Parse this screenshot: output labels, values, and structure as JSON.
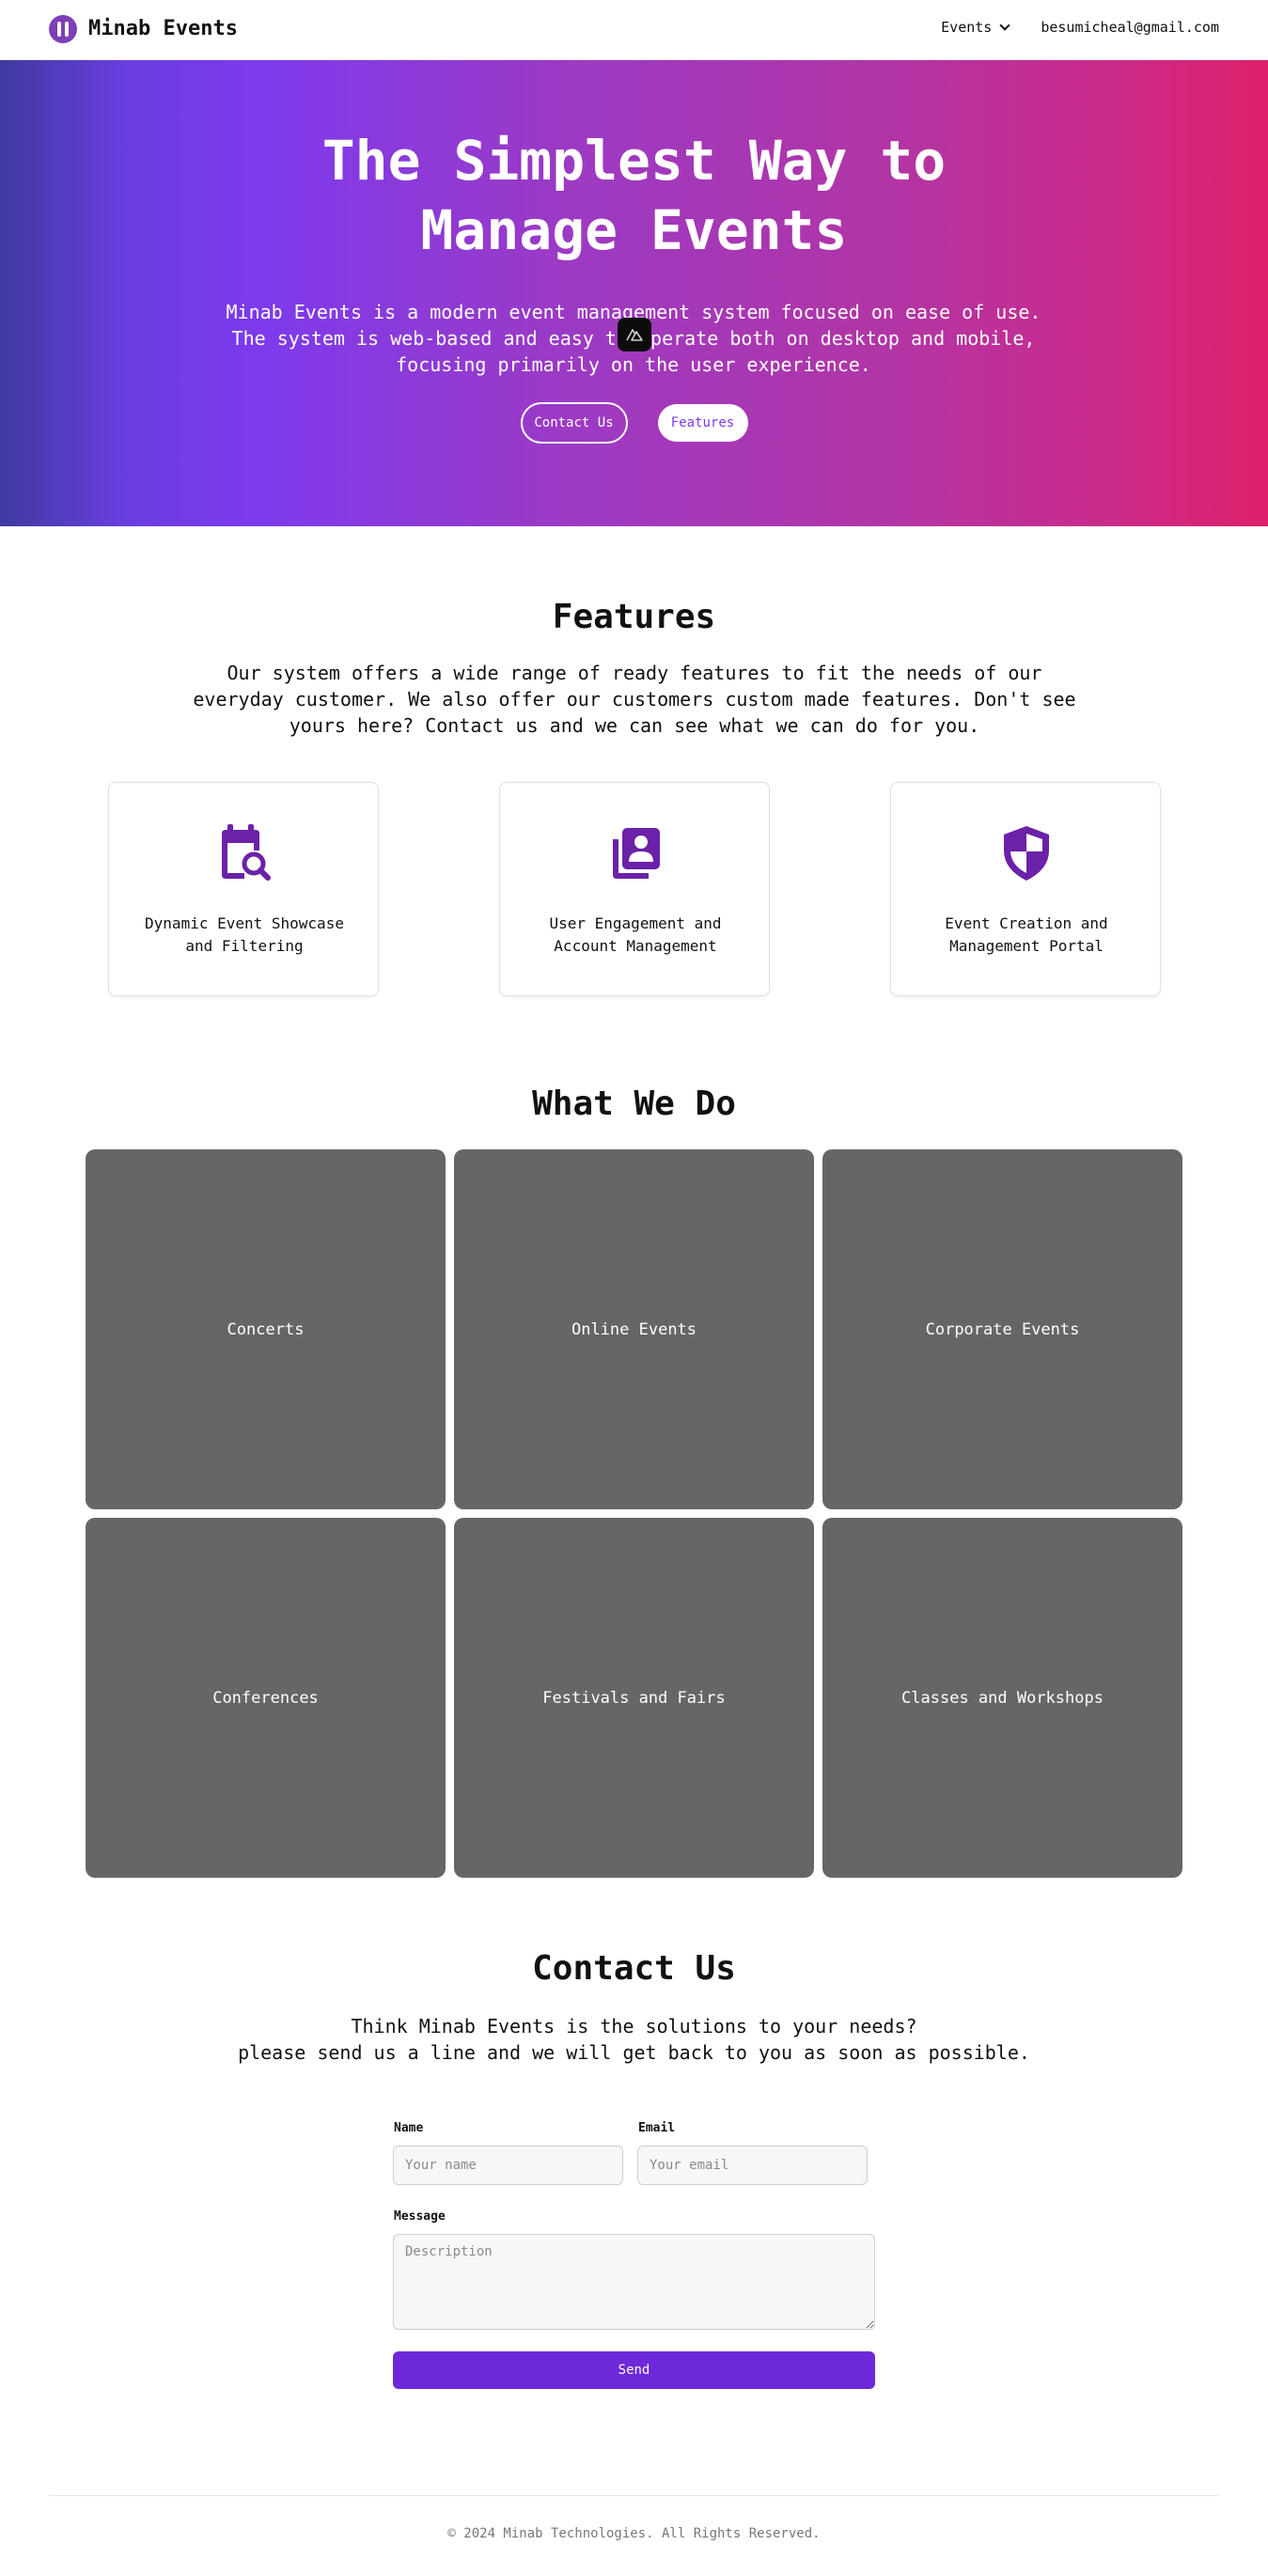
{
  "navbar": {
    "brand_name": "Minab Events",
    "events_label": "Events",
    "email": "besumicheal@gmail.com"
  },
  "hero": {
    "title_line1": "The Simplest Way to",
    "title_line2": "Manage Events",
    "description": "Minab Events is a modern event management system focused on ease of use. The system is web-based and easy to operate both on desktop and mobile, focusing primarily on the user experience.",
    "contact_button": "Contact Us",
    "features_button": "Features"
  },
  "features": {
    "title": "Features",
    "description": "Our system offers a wide range of ready features to fit the needs of our everyday customer. We also offer our customers custom made features. Don't see yours here? Contact us and we can see what we can do for you.",
    "items": [
      {
        "label": "Dynamic Event Showcase and Filtering",
        "icon": "calendar-search-icon"
      },
      {
        "label": "User Engagement and Account Management",
        "icon": "user-card-icon"
      },
      {
        "label": "Event Creation and Management Portal",
        "icon": "shield-icon"
      }
    ]
  },
  "what_we_do": {
    "title": "What We Do",
    "tiles": [
      "Concerts",
      "Online Events",
      "Corporate Events",
      "Conferences",
      "Festivals and Fairs",
      "Classes and Workshops"
    ]
  },
  "contact": {
    "title": "Contact Us",
    "subtitle_line1": "Think Minab Events is the solutions to your needs?",
    "subtitle_line2": "please send us a line and we will get back to you as soon as possible.",
    "name_label": "Name",
    "name_placeholder": "Your name",
    "email_label": "Email",
    "email_placeholder": "Your email",
    "message_label": "Message",
    "message_placeholder": "Description",
    "send_button": "Send"
  },
  "footer": {
    "copyright": "© 2024 Minab Technologies. All Rights Reserved."
  },
  "colors": {
    "accent": "#7c3aed",
    "icon_purple": "#6b21a8",
    "send_button": "#6d28d9",
    "tile_gray": "#666666"
  }
}
